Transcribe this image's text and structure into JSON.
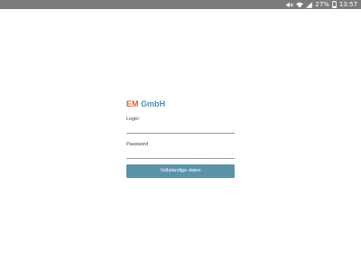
{
  "status_bar": {
    "battery_text": "27%",
    "time": "13:57",
    "icons": [
      "mute-icon",
      "wifi-icon",
      "signal-icon",
      "battery-icon"
    ]
  },
  "brand": {
    "part1": "EM",
    "part2": "GmbH",
    "color_part1": "#d9622b",
    "color_part2": "#4a8eaa"
  },
  "form": {
    "login_label": "Login:",
    "login_value": "",
    "password_label": "Password",
    "password_value": "",
    "submit_label": "Vollständige daten"
  },
  "colors": {
    "status_bar_bg": "#7b7b7b",
    "button_bg": "#5b93a9"
  }
}
